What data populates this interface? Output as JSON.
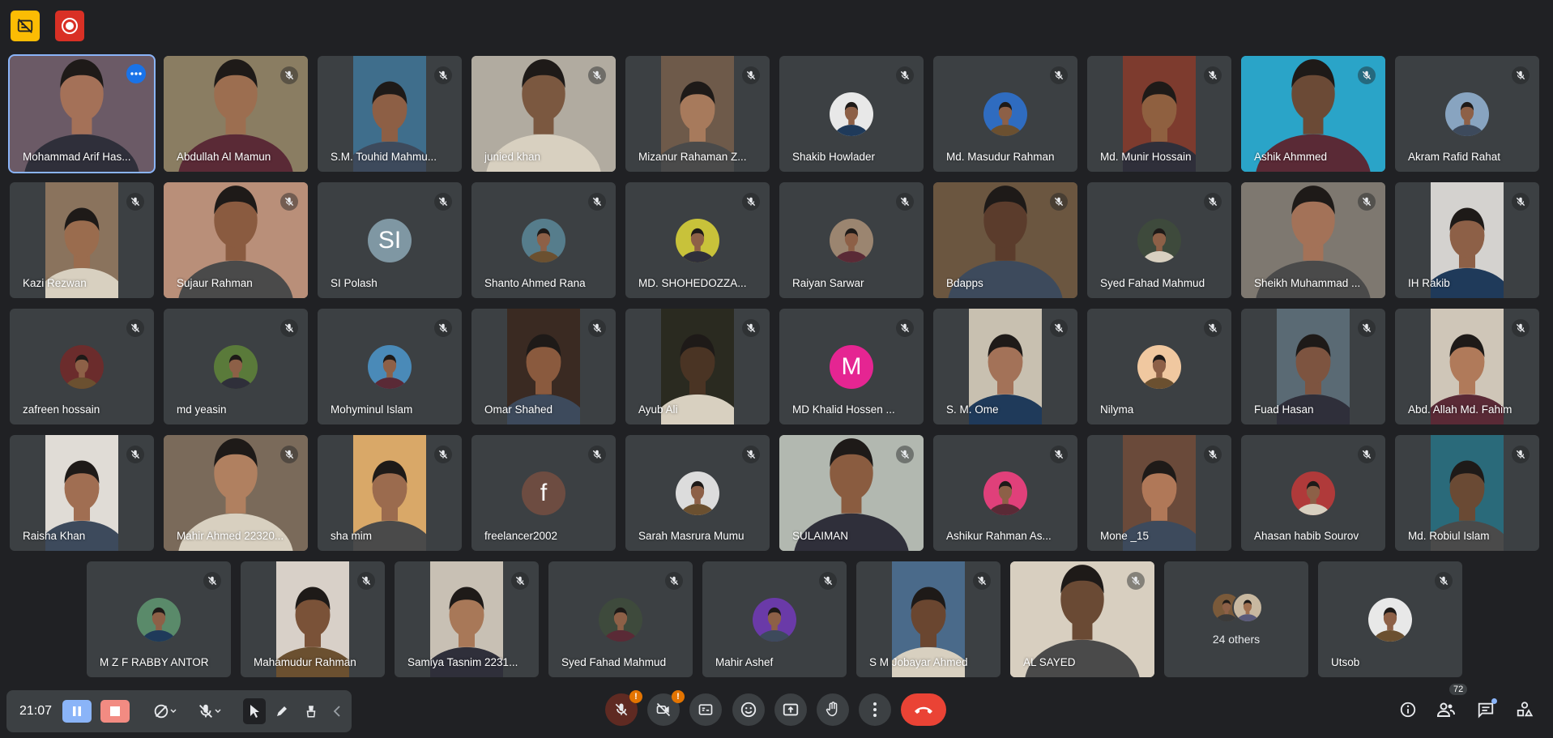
{
  "colors": {
    "background": "#202124",
    "tile": "#3c4043",
    "accent": "#8ab4f8",
    "hangup": "#ea4335",
    "stop": "#f28b82",
    "warn": "#e37400",
    "top_yellow": "#fbbc04",
    "top_red": "#d93025"
  },
  "top_controls": [
    {
      "name": "captions-off-indicator",
      "icon": "no-captions-icon"
    },
    {
      "name": "recording-indicator",
      "icon": "record-icon"
    }
  ],
  "participants": [
    {
      "name": "Mohammad Arif Has...",
      "type": "video",
      "active": true,
      "bg": "#6b5a66",
      "skin": "#a47158"
    },
    {
      "name": "Abdullah Al Mamun",
      "type": "video",
      "bg": "#8a7d62",
      "skin": "#9c6e50"
    },
    {
      "name": "S.M. Touhid Mahmu...",
      "type": "portrait",
      "bg": "#3f6e8c",
      "skin": "#8d5f45"
    },
    {
      "name": "junied khan",
      "type": "video",
      "bg": "#b1aba0",
      "skin": "#7b5840"
    },
    {
      "name": "Mizanur Rahaman Z...",
      "type": "portrait",
      "bg": "#6e5a4a",
      "skin": "#a77a5c"
    },
    {
      "name": "Shakib Howlader",
      "type": "avatar",
      "color": "#e8e8e8"
    },
    {
      "name": "Md. Masudur Rahman",
      "type": "avatar",
      "color": "#2f6cc0"
    },
    {
      "name": "Md. Munir Hossain",
      "type": "portrait",
      "bg": "#7d3b2e",
      "skin": "#8f6040"
    },
    {
      "name": "Ashik Ahmmed",
      "type": "video",
      "bg": "#2aa4c8",
      "skin": "#6b4a36"
    },
    {
      "name": "Akram Rafid Rahat",
      "type": "avatar",
      "color": "#88a4c0"
    },
    {
      "name": "Kazi Rezwan",
      "type": "portrait",
      "bg": "#8a735d",
      "skin": "#9a6c4e"
    },
    {
      "name": "Sujaur Rahman",
      "type": "video",
      "bg": "#b98f79",
      "skin": "#8a5b40"
    },
    {
      "name": "SI Polash",
      "type": "letter",
      "letter": "SI",
      "color": "#7f97a3"
    },
    {
      "name": "Shanto Ahmed Rana",
      "type": "avatar",
      "color": "#567d8c"
    },
    {
      "name": "MD. SHOHEDOZZA...",
      "type": "avatar",
      "color": "#c8c23a"
    },
    {
      "name": "Raiyan Sarwar",
      "type": "avatar",
      "color": "#9b8570"
    },
    {
      "name": "Bdapps",
      "type": "video",
      "bg": "#6b5640",
      "skin": "#5b3c2c"
    },
    {
      "name": "Syed Fahad Mahmud",
      "type": "avatar",
      "color": "#3e4a3c"
    },
    {
      "name": "Sheikh Muhammad ...",
      "type": "video",
      "bg": "#7e7870",
      "skin": "#a37258"
    },
    {
      "name": "IH Rakib",
      "type": "portrait",
      "bg": "#d4d2cf",
      "skin": "#8d6047"
    },
    {
      "name": "zafreen hossain",
      "type": "avatar",
      "color": "#6b2c2c"
    },
    {
      "name": "md yeasin",
      "type": "avatar",
      "color": "#5a7a3a"
    },
    {
      "name": "Mohyminul Islam",
      "type": "avatar",
      "color": "#4a8ab8"
    },
    {
      "name": "Omar Shahed",
      "type": "portrait",
      "bg": "#3a2a22",
      "skin": "#8a5a3e"
    },
    {
      "name": "Ayub Ali",
      "type": "portrait",
      "bg": "#2a2a20",
      "skin": "#4a3424"
    },
    {
      "name": "MD Khalid Hossen ...",
      "type": "letter",
      "letter": "M",
      "color": "#e52592"
    },
    {
      "name": "S. M. Ome",
      "type": "portrait",
      "bg": "#c8c0b0",
      "skin": "#a37258"
    },
    {
      "name": "Nilyma",
      "type": "avatar",
      "color": "#f0c8a0"
    },
    {
      "name": "Fuad Hasan",
      "type": "portrait",
      "bg": "#5a6a74",
      "skin": "#7d5440"
    },
    {
      "name": "Abd. Allah Md. Fahim",
      "type": "portrait",
      "bg": "#cfc6b8",
      "skin": "#b07a5a"
    },
    {
      "name": "Raisha Khan",
      "type": "portrait",
      "bg": "#e0dcd6",
      "skin": "#a06e52"
    },
    {
      "name": "Mahir Ahmed 22320...",
      "type": "video",
      "bg": "#7a6a5a",
      "skin": "#b08060"
    },
    {
      "name": "sha mim",
      "type": "portrait",
      "bg": "#d9a868",
      "skin": "#9b6b4e"
    },
    {
      "name": "freelancer2002",
      "type": "letter",
      "letter": "f",
      "color": "#6d4c41"
    },
    {
      "name": "Sarah Masrura Mumu",
      "type": "avatar",
      "color": "#dcdcdc"
    },
    {
      "name": "SULAIMAN",
      "type": "video",
      "bg": "#b2b8b0",
      "skin": "#8a5c40"
    },
    {
      "name": "Ashikur Rahman As...",
      "type": "avatar",
      "color": "#e0407a"
    },
    {
      "name": "Mone _15",
      "type": "portrait",
      "bg": "#6a4a3a",
      "skin": "#b07858"
    },
    {
      "name": "Ahasan habib Sourov",
      "type": "avatar",
      "color": "#b03a3a"
    },
    {
      "name": "Md. Robiul Islam",
      "type": "portrait",
      "bg": "#2a6a7a",
      "skin": "#6a4a34"
    },
    {
      "name": "M Z F RABBY ANTOR",
      "type": "avatar",
      "color": "#5a8a6a"
    },
    {
      "name": "Mahamudur Rahman",
      "type": "portrait",
      "bg": "#d8d0c8",
      "skin": "#7a5238"
    },
    {
      "name": "Samiya Tasnim 2231...",
      "type": "portrait",
      "bg": "#c8c0b4",
      "skin": "#a87858"
    },
    {
      "name": "Syed Fahad Mahmud",
      "type": "avatar",
      "color": "#3e4a3c"
    },
    {
      "name": "Mahir Ashef",
      "type": "avatar",
      "color": "#6a3aa8"
    },
    {
      "name": "S M Jobayar Ahmed",
      "type": "portrait",
      "bg": "#4a6a8a",
      "skin": "#6a4630"
    },
    {
      "name": "AL SAYED",
      "type": "video",
      "bg": "#d8cfc0",
      "skin": "#6a4a34"
    },
    {
      "name": "24 others",
      "type": "others"
    },
    {
      "name": "Utsob",
      "type": "avatar",
      "color": "#e8e8e8"
    }
  ],
  "toolbar": {
    "time": "21:07",
    "tool_icons": [
      "pause-icon",
      "stop-icon",
      "camera-off-icon",
      "mic-off-icon",
      "pointer-icon",
      "pen-icon",
      "eraser-icon",
      "collapse-icon"
    ]
  },
  "center_controls": [
    "mic-off-icon",
    "camera-off-icon",
    "captions-icon",
    "emoji-icon",
    "present-icon",
    "raise-hand-icon",
    "more-options-icon",
    "hang-up-icon"
  ],
  "right_controls": {
    "icons": [
      "info-icon",
      "people-icon",
      "chat-icon",
      "activities-icon"
    ],
    "people_count": "72"
  }
}
